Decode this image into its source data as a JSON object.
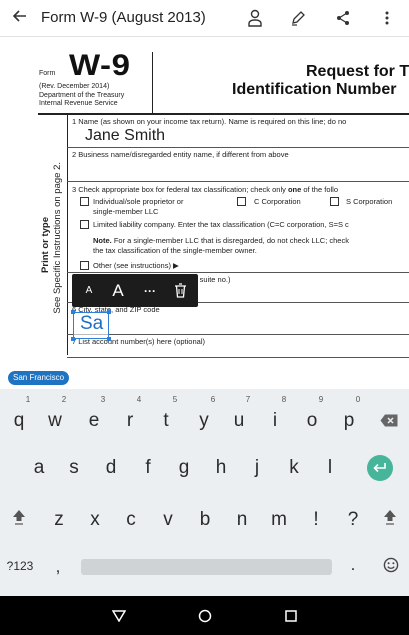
{
  "app_bar": {
    "back_icon": "arrow-left-icon",
    "title": "Form W-9 (August 2013)",
    "actions": [
      "person-icon",
      "pen-icon",
      "share-icon",
      "more-vert-icon"
    ]
  },
  "document": {
    "form_label": "Form",
    "form_number": "W-9",
    "revision_lines": [
      "(Rev. December 2014)",
      "Department of the Treasury",
      "Internal Revenue Service"
    ],
    "title_line1": "Request for T",
    "title_line2": "Identification Number",
    "vertical_text_1": "Print or type",
    "vertical_text_2": "See Specific Instructions on page 2.",
    "line1_label": "1  Name (as shown on your income tax return). Name is required on this line; do no",
    "line1_value": "Jane Smith",
    "line2_label": "2  Business name/disregarded entity name, if different from above",
    "line3_label_pre": "3  Check appropriate box for federal tax classification; check only ",
    "line3_label_bold": "one",
    "line3_label_post": " of the follo",
    "option_individual_1": "Individual/sole proprietor or",
    "option_individual_2": "single-member LLC",
    "option_ccorp": "C Corporation",
    "option_scorp": "S Corporation",
    "option_llc": "Limited liability company. Enter the tax classification (C=C corporation, S=S c",
    "note_bold": "Note.",
    "note_text_1": " For a single-member LLC that is disregarded, do not check LLC; check",
    "note_text_2": "the tax classification of the single-member owner.",
    "option_other": "Other (see instructions) ▶",
    "line5_fragment": "d apt. or suite no.)",
    "line6_label": "6  City, state, and ZIP code",
    "line7_label": "7  List account number(s) here (optional)",
    "typed_text": "Sa"
  },
  "annotation_toolbar": {
    "small_a": "A",
    "large_a": "A",
    "more": "···",
    "delete_icon": "trash-icon"
  },
  "suggestion": {
    "chip": "San Francisco"
  },
  "keyboard": {
    "row1": [
      {
        "num": "1",
        "ch": "q"
      },
      {
        "num": "2",
        "ch": "w"
      },
      {
        "num": "3",
        "ch": "e"
      },
      {
        "num": "4",
        "ch": "r"
      },
      {
        "num": "5",
        "ch": "t"
      },
      {
        "num": "6",
        "ch": "y"
      },
      {
        "num": "7",
        "ch": "u"
      },
      {
        "num": "8",
        "ch": "i"
      },
      {
        "num": "9",
        "ch": "o"
      },
      {
        "num": "0",
        "ch": "p"
      }
    ],
    "row2": [
      "a",
      "s",
      "d",
      "f",
      "g",
      "h",
      "j",
      "k",
      "l"
    ],
    "row3": [
      "z",
      "x",
      "c",
      "v",
      "b",
      "n",
      "m",
      "!",
      "?"
    ],
    "symbols_key": "?123",
    "comma_key": ",",
    "period_key": ".",
    "backspace_icon": "backspace-icon",
    "enter_icon": "enter-icon",
    "shift_icon": "shift-icon",
    "emoji_icon": "emoji-icon"
  },
  "nav_bar": {
    "back_icon": "nav-back-icon",
    "home_icon": "nav-home-icon",
    "recents_icon": "nav-recents-icon"
  },
  "colors": {
    "accent": "#2f7fd6",
    "chip": "#1f73c3",
    "enter_key": "#46b59a",
    "keyboard_bg": "#eceff1"
  }
}
